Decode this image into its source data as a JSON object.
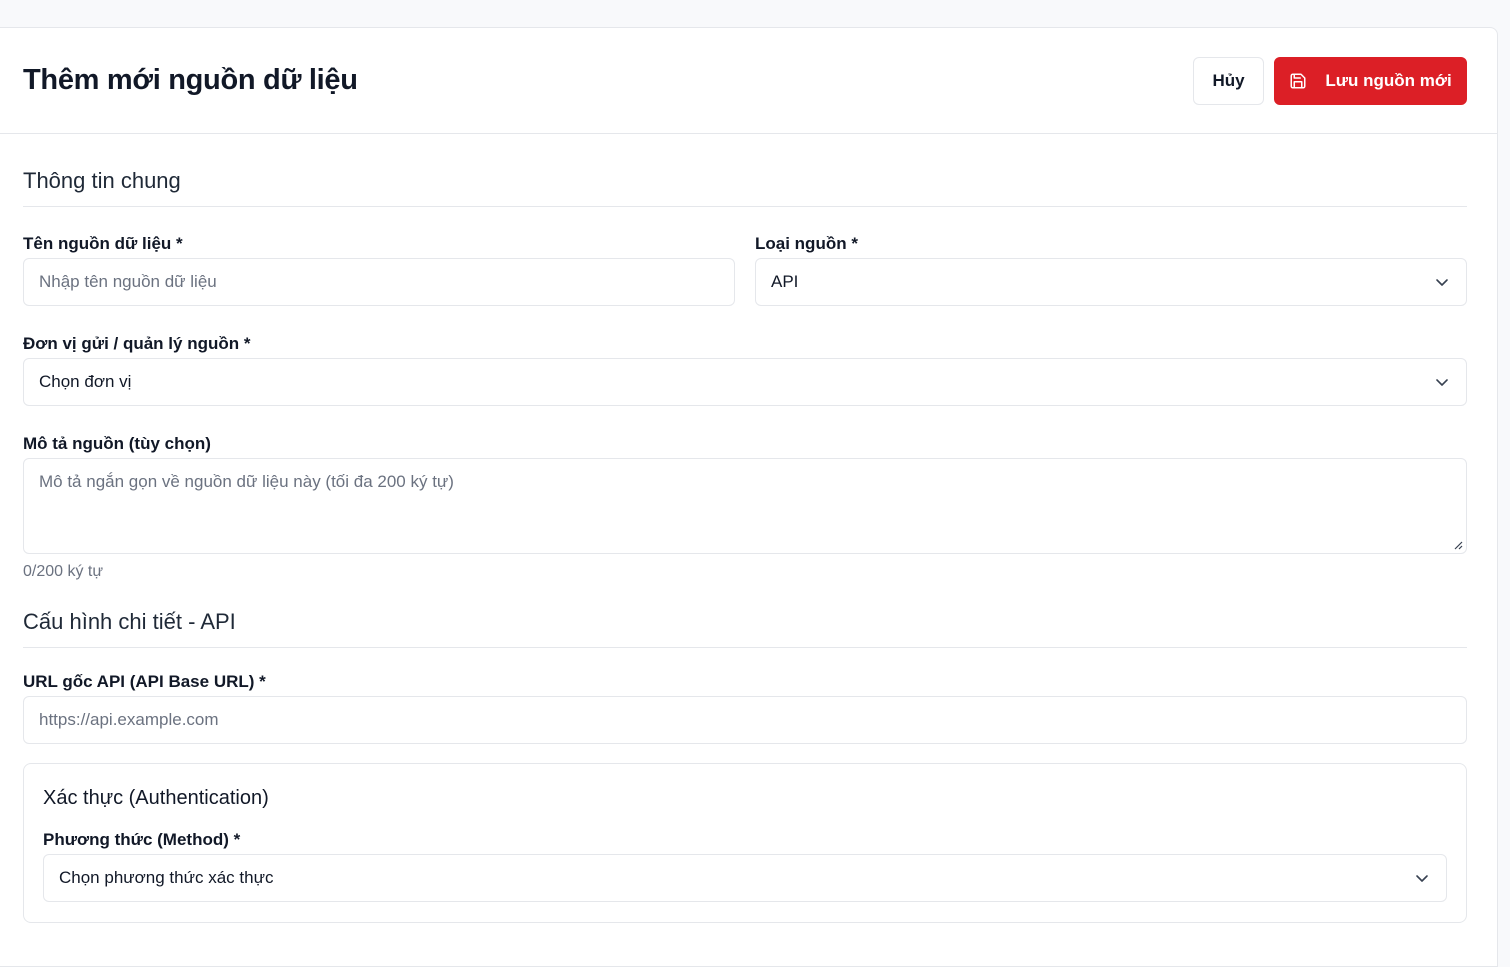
{
  "header": {
    "title": "Thêm mới nguồn dữ liệu",
    "cancel_label": "Hủy",
    "save_label": "Lưu nguồn mới"
  },
  "general": {
    "section_title": "Thông tin chung",
    "name_label": "Tên nguồn dữ liệu *",
    "name_placeholder": "Nhập tên nguồn dữ liệu",
    "name_value": "",
    "type_label": "Loại nguồn *",
    "type_value": "API",
    "unit_label": "Đơn vị gửi / quản lý nguồn *",
    "unit_value": "Chọn đơn vị",
    "desc_label": "Mô tả nguồn (tùy chọn)",
    "desc_placeholder": "Mô tả ngắn gọn về nguồn dữ liệu này (tối đa 200 ký tự)",
    "desc_counter": "0/200 ký tự"
  },
  "api_config": {
    "section_title": "Cấu hình chi tiết - API",
    "base_url_label": "URL gốc API (API Base URL) *",
    "base_url_placeholder": "https://api.example.com",
    "auth": {
      "title": "Xác thực (Authentication)",
      "method_label": "Phương thức (Method) *",
      "method_value": "Chọn phương thức xác thực"
    }
  },
  "colors": {
    "primary": "#dc1f26",
    "border": "#e5e7eb",
    "muted_text": "#6b7280",
    "background": "#f8f9fb"
  },
  "icons": {
    "save": "floppy-disk-icon",
    "dropdown": "chevron-down-icon",
    "resize": "resize-handle-icon"
  }
}
